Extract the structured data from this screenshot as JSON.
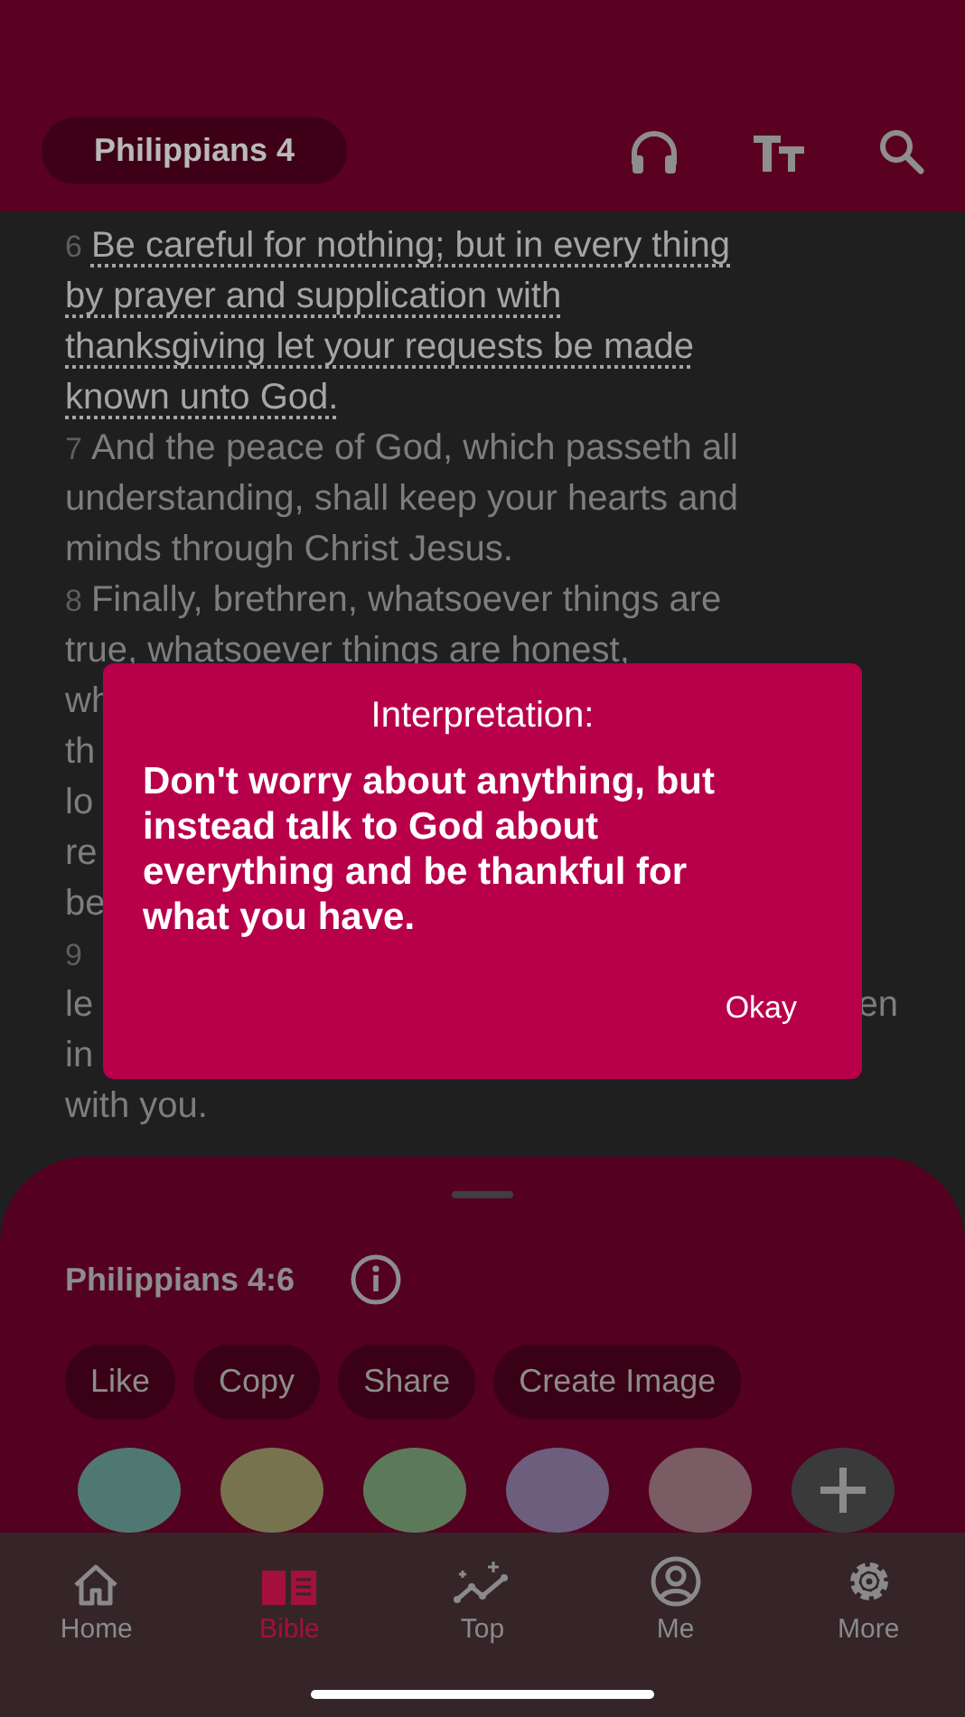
{
  "header": {
    "title": "Philippians 4"
  },
  "lines": [
    {
      "verse": "6",
      "text": "Be careful for nothing; but in every thing",
      "highlighted": true
    },
    {
      "text": "by prayer and supplication with",
      "highlighted": true
    },
    {
      "text": "thanksgiving let your requests be made",
      "highlighted": true
    },
    {
      "text": "known unto God.",
      "highlighted": true
    },
    {
      "verse": "7",
      "text": "And the peace of God, which passeth all",
      "highlighted": false
    },
    {
      "text": "understanding, shall keep your hearts and",
      "highlighted": false
    },
    {
      "text": "minds through Christ Jesus.",
      "highlighted": false
    },
    {
      "verse": "8",
      "text": "Finally, brethren, whatsoever things are",
      "highlighted": false
    },
    {
      "text": "true, whatsoever things are honest,",
      "highlighted": false
    },
    {
      "text": "wh",
      "highlighted": false
    },
    {
      "text": "th",
      "highlighted": false
    },
    {
      "text": "lo",
      "highlighted": false
    },
    {
      "text": "re",
      "highlighted": false
    },
    {
      "text": "be",
      "highlighted": false
    },
    {
      "verse": "9"
    },
    {
      "text": "le",
      "text_right": "en",
      "highlighted": false
    },
    {
      "text": "in",
      "highlighted": false
    },
    {
      "text": "with you.",
      "highlighted": false
    }
  ],
  "dialog": {
    "title": "Interpretation:",
    "body": "Don't worry about anything, but instead talk to God about everything and be thankful for what you have.",
    "button": "Okay"
  },
  "sheet": {
    "reference": "Philippians 4:6",
    "actions": [
      "Like",
      "Copy",
      "Share",
      "Create Image"
    ],
    "colors": [
      {
        "color": "#4f7872"
      },
      {
        "color": "#77734f"
      },
      {
        "color": "#5c7a5a"
      },
      {
        "color": "#6c5e7c"
      },
      {
        "color": "#7a5c64"
      }
    ]
  },
  "tabs": [
    {
      "label": "Home",
      "kind": "home",
      "selected": false
    },
    {
      "label": "Bible",
      "kind": "book",
      "selected": true
    },
    {
      "label": "Top",
      "kind": "trend",
      "selected": false
    },
    {
      "label": "Me",
      "kind": "user",
      "selected": false
    },
    {
      "label": "More",
      "kind": "gear",
      "selected": false
    }
  ]
}
